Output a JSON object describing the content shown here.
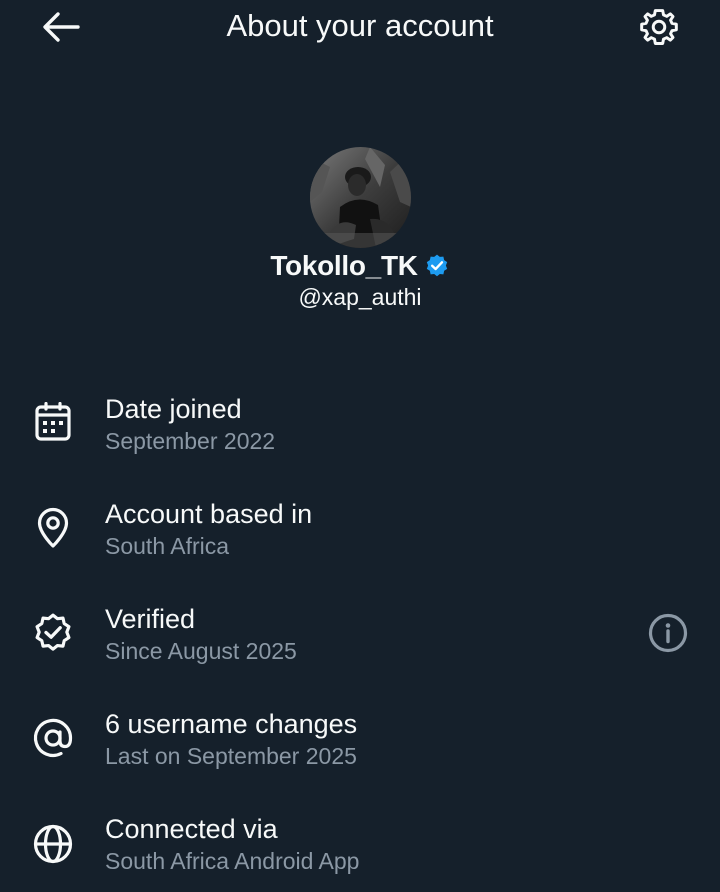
{
  "header": {
    "back_icon": "arrow-left-icon",
    "title": "About your account",
    "settings_icon": "gear-icon"
  },
  "profile": {
    "display_name": "Tokollo_TK",
    "handle": "@xap_authi",
    "verified_badge_color": "#1d9bf0",
    "verified_icon": "verified-badge-icon"
  },
  "rows": [
    {
      "icon": "calendar-icon",
      "title": "Date joined",
      "subtitle": "September 2022"
    },
    {
      "icon": "location-pin-icon",
      "title": "Account based in",
      "subtitle": "South Africa"
    },
    {
      "icon": "verified-check-icon",
      "title": "Verified",
      "subtitle": "Since August 2025",
      "action_icon": "info-icon"
    },
    {
      "icon": "at-sign-icon",
      "title": "6 username changes",
      "subtitle": "Last on September 2025"
    },
    {
      "icon": "globe-icon",
      "title": "Connected via",
      "subtitle": "South Africa Android App"
    }
  ],
  "colors": {
    "background": "#15202b",
    "text_primary": "#f7f9f9",
    "text_secondary": "#8b98a5",
    "accent": "#1d9bf0"
  }
}
